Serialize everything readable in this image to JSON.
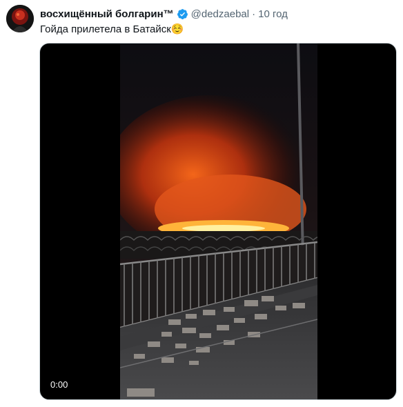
{
  "user": {
    "display_name": "восхищённый болгарин™",
    "handle": "@dedzaebal",
    "separator": "·",
    "time": "10 год"
  },
  "tweet": {
    "text": "Гойда прилетела в Батайск☺️"
  },
  "media": {
    "type": "video",
    "timecode": "0:00"
  },
  "colors": {
    "verified_badge": "#1d9bf0",
    "secondary_text": "#536471"
  }
}
